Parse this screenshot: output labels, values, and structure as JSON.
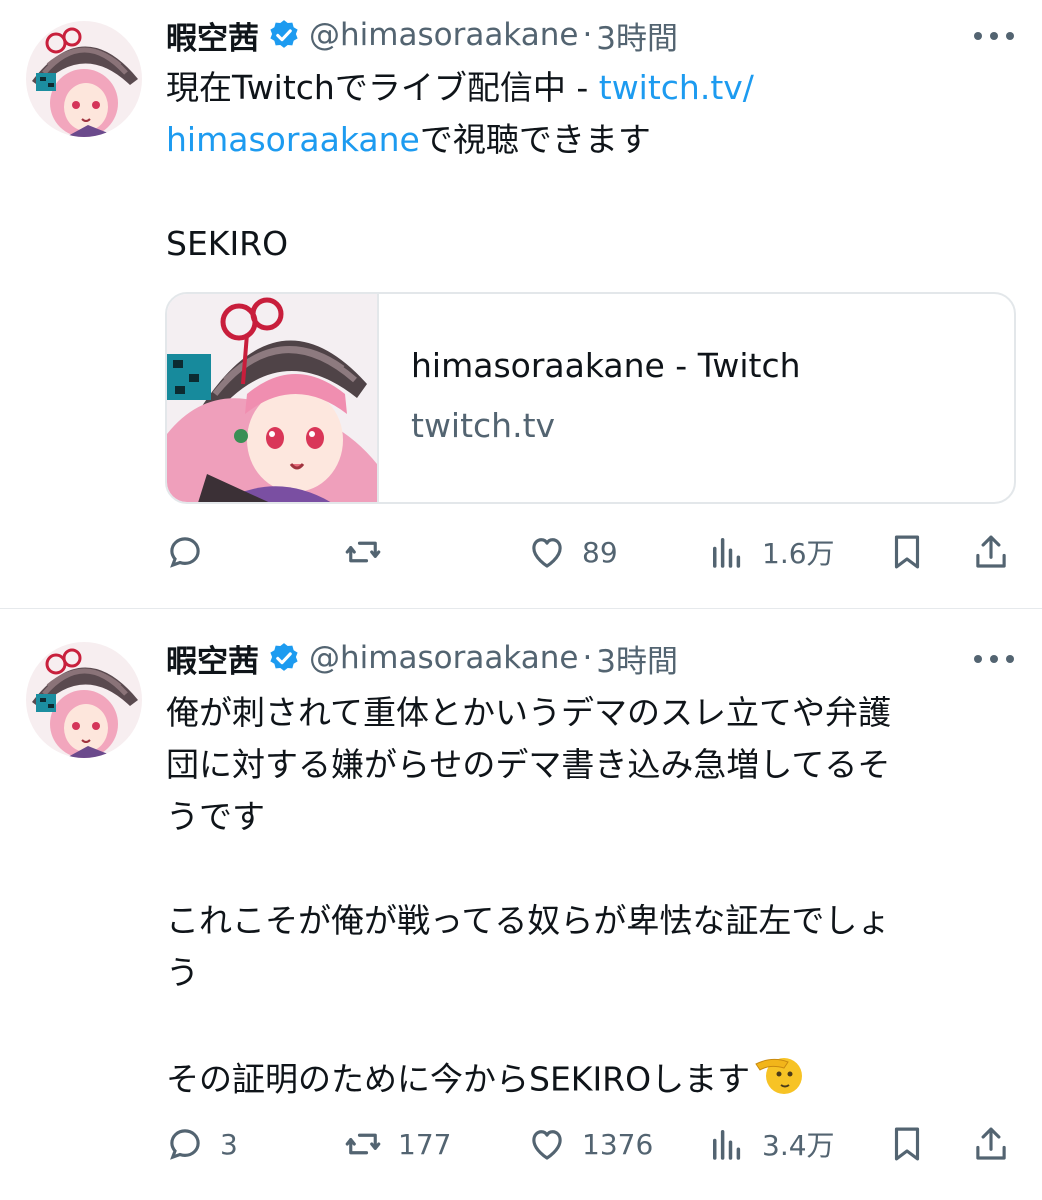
{
  "tweets": [
    {
      "author": {
        "name": "暇空茜",
        "handle": "@himasoraakane",
        "time": "3時間",
        "separator": "·"
      },
      "lines": [
        {
          "text": "現在Twitchでライブ配信中 - ",
          "link": "twitch.tv/"
        },
        {
          "link": "himasoraakane",
          "text": "で視聴できます"
        },
        {
          "blank": true
        },
        {
          "text": "SEKIRO"
        }
      ],
      "card": {
        "title": "himasoraakane - Twitch",
        "domain": "twitch.tv"
      },
      "stats": {
        "replies": "",
        "retweets": "",
        "likes": "89",
        "views": "1.6万"
      }
    },
    {
      "author": {
        "name": "暇空茜",
        "handle": "@himasoraakane",
        "time": "3時間",
        "separator": "·"
      },
      "lines": [
        {
          "text": "俺が刺されて重体とかいうデマのスレ立てや弁護"
        },
        {
          "text": "団に対する嫌がらせのデマ書き込み急増してるそ"
        },
        {
          "text": "うです"
        },
        {
          "blank": true
        },
        {
          "text": "これこそが俺が戦ってる奴らが卑怯な証左でしょ"
        },
        {
          "text": "う"
        },
        {
          "blank": true
        },
        {
          "text": "その証明のために今からSEKIROします",
          "emoji": "saluting-face"
        }
      ],
      "stats": {
        "replies": "3",
        "retweets": "177",
        "likes": "1376",
        "views": "3.4万"
      }
    }
  ],
  "colors": {
    "link": "#1d9bf0",
    "muted": "#536471",
    "text": "#0f1419",
    "verified": "#1d9bf0"
  }
}
